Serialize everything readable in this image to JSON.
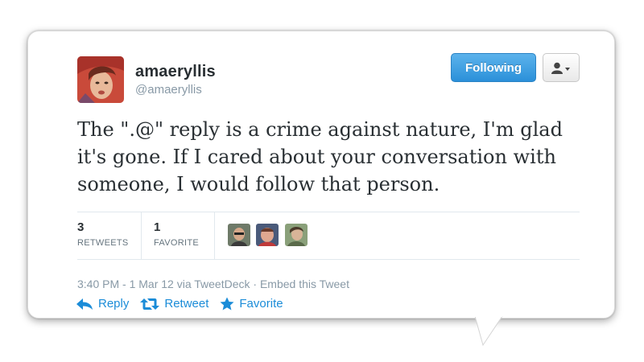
{
  "user": {
    "name": "amaeryllis",
    "handle": "@amaeryllis"
  },
  "follow_button": "Following",
  "tweet_text": "The \".@\" reply is a crime against nature, I'm glad it's gone. If I cared about your conversation with someone, I would follow that person.",
  "stats": {
    "retweets_count": "3",
    "retweets_label": "RETWEETS",
    "favorites_count": "1",
    "favorites_label": "FAVORITE"
  },
  "meta": {
    "timestamp": "3:40 PM - 1 Mar 12",
    "via": "via TweetDeck",
    "separator": "·",
    "embed": "Embed this Tweet"
  },
  "actions": {
    "reply": "Reply",
    "retweet": "Retweet",
    "favorite": "Favorite"
  },
  "colors": {
    "accent": "#1b8cd8",
    "follow_button": "#2b90d9"
  },
  "icons": [
    "user-menu-icon",
    "reply-icon",
    "retweet-icon",
    "favorite-icon"
  ]
}
